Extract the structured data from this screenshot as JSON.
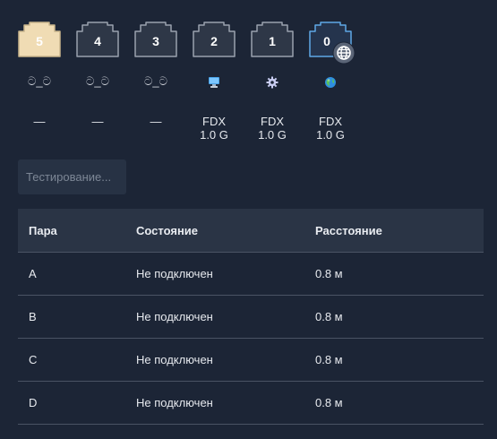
{
  "ports": [
    {
      "number": "5",
      "status_icon": "unplugged-icon",
      "status_glyph": "ට_ට",
      "speed_line1": "—",
      "speed_line2": "",
      "active": true
    },
    {
      "number": "4",
      "status_icon": "unplugged-icon",
      "status_glyph": "ට_ට",
      "speed_line1": "—",
      "speed_line2": "",
      "active": false
    },
    {
      "number": "3",
      "status_icon": "unplugged-icon",
      "status_glyph": "ට_ට",
      "speed_line1": "—",
      "speed_line2": "",
      "active": false
    },
    {
      "number": "2",
      "status_icon": "computer-icon",
      "status_glyph": "",
      "speed_line1": "FDX",
      "speed_line2": "1.0 G",
      "active": false
    },
    {
      "number": "1",
      "status_icon": "gear-icon",
      "status_glyph": "",
      "speed_line1": "FDX",
      "speed_line2": "1.0 G",
      "active": false
    },
    {
      "number": "0",
      "status_icon": "globe-icon",
      "status_glyph": "",
      "speed_line1": "FDX",
      "speed_line2": "1.0 G",
      "active": false
    }
  ],
  "test_button": {
    "label": "Тестирование..."
  },
  "table": {
    "headers": [
      "Пара",
      "Состояние",
      "Расстояние"
    ],
    "rows": [
      [
        "A",
        "Не подключен",
        "0.8 м"
      ],
      [
        "B",
        "Не подключен",
        "0.8 м"
      ],
      [
        "C",
        "Не подключен",
        "0.8 м"
      ],
      [
        "D",
        "Не подключен",
        "0.8 м"
      ]
    ]
  },
  "colors": {
    "background": "#1c2536",
    "port_active": "#f0dcb4",
    "port_idle": "#2e3747",
    "port_wan": "#25344d"
  }
}
